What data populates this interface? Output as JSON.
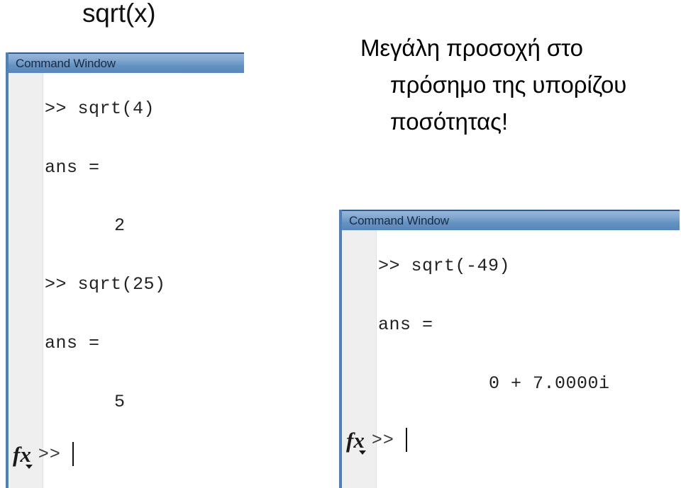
{
  "slide": {
    "title": "sqrt(x)",
    "note_lines": [
      "Μεγάλη προσοχή στο",
      "πρόσημο της υπορίζου",
      "ποσότητας!"
    ]
  },
  "colors": {
    "titlebar_blue": "#6392c2",
    "rail_blue": "#4e81b8",
    "gutter_gray": "#efefef",
    "text_dark": "#222222"
  },
  "left_window": {
    "title": "Command Window",
    "icon": "command-window-icon",
    "lines": [
      {
        "text": ">> sqrt(4)",
        "indent": 0
      },
      {
        "text": "ans =",
        "indent": 0
      },
      {
        "text": "2",
        "indent": 100
      },
      {
        "text": ">> sqrt(25)",
        "indent": 0
      },
      {
        "text": "ans =",
        "indent": 0
      },
      {
        "text": "5",
        "indent": 100
      }
    ],
    "prompt": {
      "fx_label": "fx",
      "prompt_symbol": ">>",
      "input_value": ""
    }
  },
  "right_window": {
    "title": "Command Window",
    "icon": "command-window-icon",
    "lines": [
      {
        "text": ">> sqrt(-49)",
        "indent": 0
      },
      {
        "text": "ans =",
        "indent": 0
      },
      {
        "text": "0 + 7.0000i",
        "indent": 158
      }
    ],
    "prompt": {
      "fx_label": "fx",
      "prompt_symbol": ">>",
      "input_value": ""
    }
  }
}
